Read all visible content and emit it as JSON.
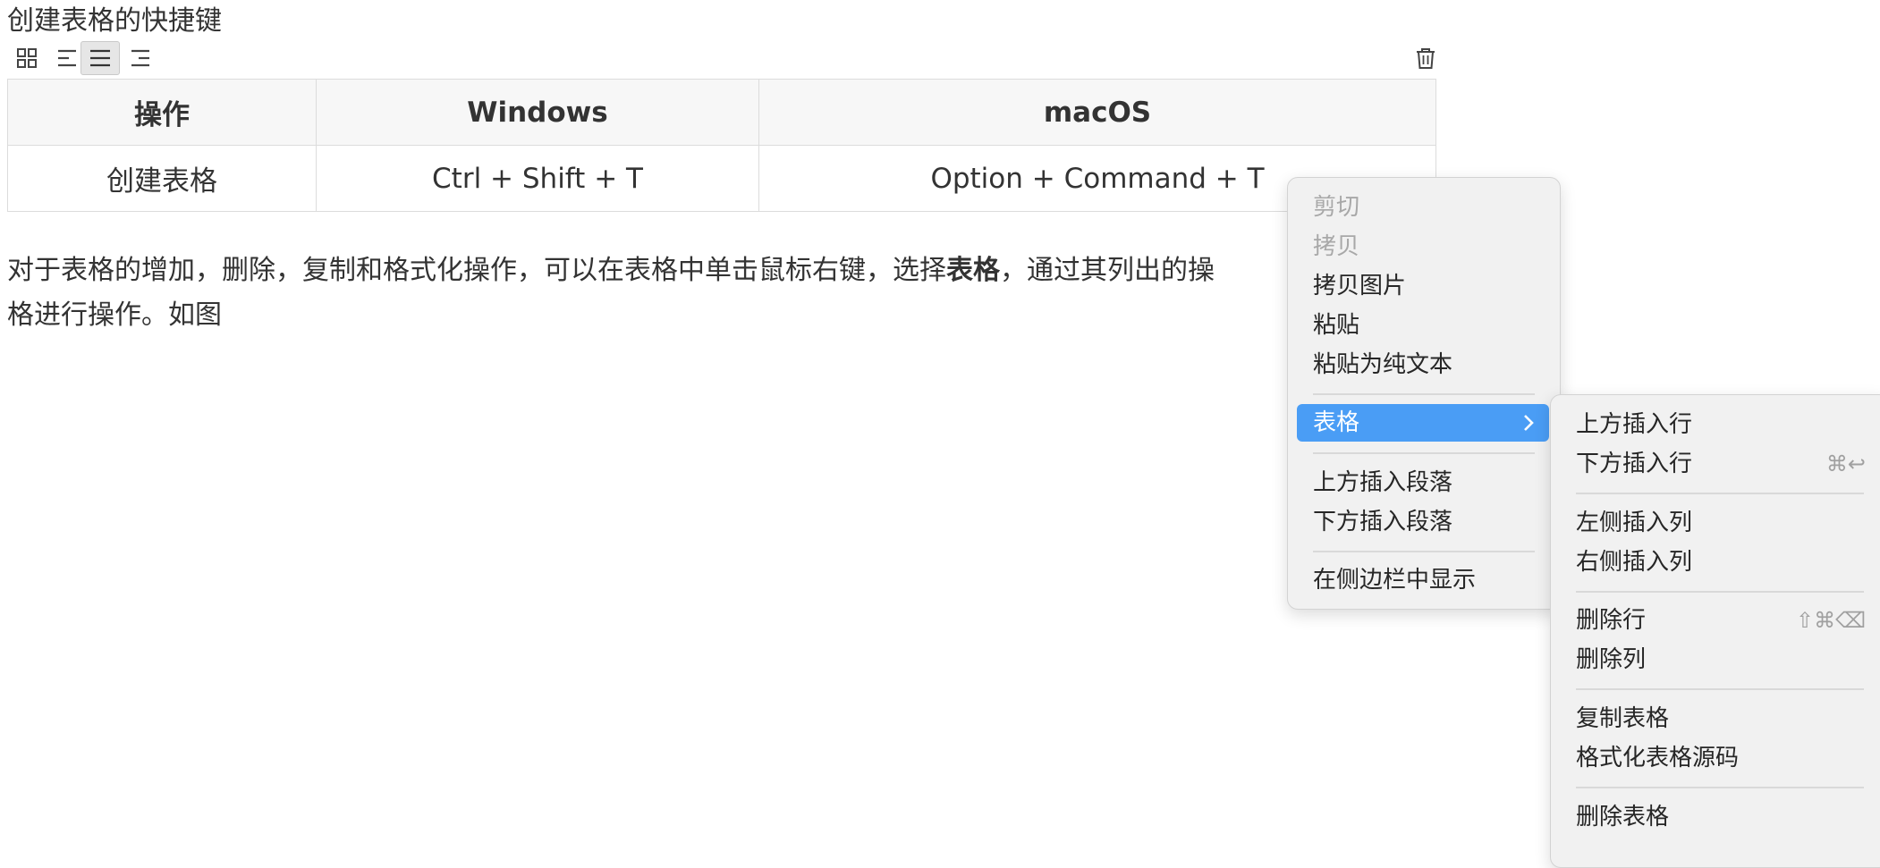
{
  "heading": "创建表格的快捷键",
  "toolbar": {
    "icons": [
      "grid-icon",
      "align-left-icon",
      "align-center-icon",
      "align-right-icon",
      "trash-icon"
    ]
  },
  "table": {
    "headers": [
      "操作",
      "Windows",
      "macOS"
    ],
    "rows": [
      [
        "创建表格",
        "Ctrl + Shift + T",
        "Option + Command + T"
      ]
    ]
  },
  "paragraph": {
    "line1_before": "对于表格的增加，删除，复制和格式化操作，可以在表格中单击鼠标右键，选择",
    "bold": "表格",
    "line1_after": "，通过其列出的操",
    "line2": "格进行操作。如图"
  },
  "context_menu": {
    "items": [
      "剪切",
      "拷贝",
      "拷贝图片",
      "粘贴",
      "粘贴为纯文本"
    ],
    "table_label": "表格",
    "insert_items": [
      "上方插入段落",
      "下方插入段落"
    ],
    "sidebar_item": "在侧边栏中显示"
  },
  "submenu": {
    "items": [
      "上方插入行",
      "下方插入行",
      "左侧插入列",
      "右侧插入列",
      "删除行",
      "删除列",
      "复制表格",
      "格式化表格源码",
      "删除表格"
    ],
    "shortcuts": {
      "insert_row_below": "⌘↩",
      "delete_row": "⇧⌘⌫"
    }
  },
  "colors": {
    "highlight": "#4a9df5",
    "text": "#333333",
    "disabled_text": "#a8a8a8",
    "menu_bg": "#f1f1f1"
  }
}
